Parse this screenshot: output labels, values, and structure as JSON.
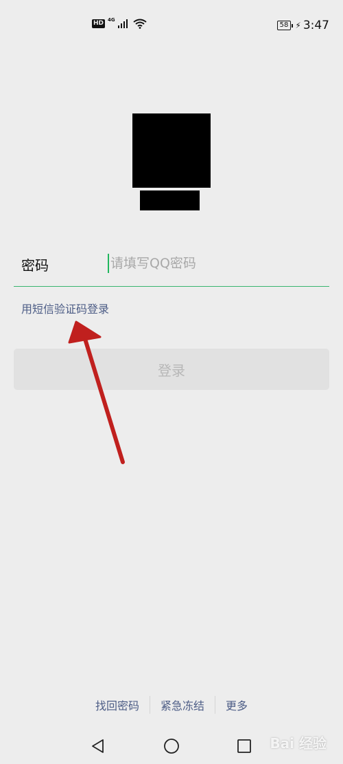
{
  "status_bar": {
    "hd_label": "HD",
    "network_type": "4G",
    "signal_icon": "signal-icon",
    "wifi_icon": "wifi-icon",
    "battery_level": "58",
    "time": "3:47"
  },
  "login": {
    "password_label": "密码",
    "password_placeholder": "请填写QQ密码",
    "sms_login_link": "用短信验证码登录",
    "login_button": "登录"
  },
  "footer": {
    "links": [
      "找回密码",
      "紧急冻结",
      "更多"
    ]
  },
  "colors": {
    "background": "#ededed",
    "accent_green": "#37b46f",
    "link_blue": "#4d5d86",
    "annotation_red": "#c0201e"
  },
  "watermark": "Bai 经验"
}
